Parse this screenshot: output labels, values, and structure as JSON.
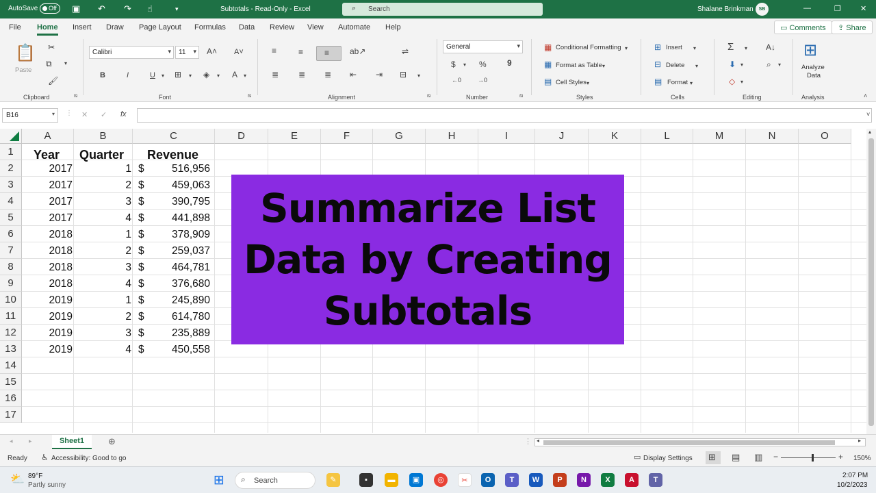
{
  "titlebar": {
    "autosave_label": "AutoSave",
    "autosave_state": "Off",
    "document_title": "Subtotals  -  Read-Only  -  Excel",
    "search_placeholder": "Search",
    "user_name": "Shalane Brinkman",
    "user_initials": "SB"
  },
  "menu": {
    "tabs": [
      "File",
      "Home",
      "Insert",
      "Draw",
      "Page Layout",
      "Formulas",
      "Data",
      "Review",
      "View",
      "Automate",
      "Help"
    ],
    "active": "Home",
    "comments_label": "Comments",
    "share_label": "Share"
  },
  "ribbon": {
    "clipboard": {
      "paste_label": "Paste",
      "group_label": "Clipboard"
    },
    "font": {
      "font_name": "Calibri",
      "font_size": "11",
      "bold": "B",
      "italic": "I",
      "underline": "U",
      "group_label": "Font"
    },
    "alignment": {
      "group_label": "Alignment"
    },
    "number": {
      "format": "General",
      "currency": "$",
      "percent": "%",
      "comma": "9",
      "group_label": "Number"
    },
    "styles": {
      "conditional": "Conditional Formatting",
      "format_table": "Format as Table",
      "cell_styles": "Cell Styles",
      "group_label": "Styles"
    },
    "cells": {
      "insert": "Insert",
      "delete": "Delete",
      "format": "Format",
      "group_label": "Cells"
    },
    "editing": {
      "group_label": "Editing"
    },
    "analysis": {
      "analyze_line1": "Analyze",
      "analyze_line2": "Data",
      "group_label": "Analysis"
    }
  },
  "formula_bar": {
    "name_box": "B16",
    "fx": "fx",
    "content": ""
  },
  "grid": {
    "columns": [
      "A",
      "B",
      "C",
      "D",
      "E",
      "F",
      "G",
      "H",
      "I",
      "J",
      "K",
      "L",
      "M",
      "N",
      "O"
    ],
    "rows": [
      "1",
      "2",
      "3",
      "4",
      "5",
      "6",
      "7",
      "8",
      "9",
      "10",
      "11",
      "12",
      "13",
      "14",
      "15",
      "16",
      "17"
    ],
    "headers": {
      "year": "Year",
      "quarter": "Quarter",
      "revenue": "Revenue"
    },
    "data": [
      {
        "year": "2017",
        "quarter": "1",
        "currency": "$",
        "revenue": "516,956"
      },
      {
        "year": "2017",
        "quarter": "2",
        "currency": "$",
        "revenue": "459,063"
      },
      {
        "year": "2017",
        "quarter": "3",
        "currency": "$",
        "revenue": "390,795"
      },
      {
        "year": "2017",
        "quarter": "4",
        "currency": "$",
        "revenue": "441,898"
      },
      {
        "year": "2018",
        "quarter": "1",
        "currency": "$",
        "revenue": "378,909"
      },
      {
        "year": "2018",
        "quarter": "2",
        "currency": "$",
        "revenue": "259,037"
      },
      {
        "year": "2018",
        "quarter": "3",
        "currency": "$",
        "revenue": "464,781"
      },
      {
        "year": "2018",
        "quarter": "4",
        "currency": "$",
        "revenue": "376,680"
      },
      {
        "year": "2019",
        "quarter": "1",
        "currency": "$",
        "revenue": "245,890"
      },
      {
        "year": "2019",
        "quarter": "2",
        "currency": "$",
        "revenue": "614,780"
      },
      {
        "year": "2019",
        "quarter": "3",
        "currency": "$",
        "revenue": "235,889"
      },
      {
        "year": "2019",
        "quarter": "4",
        "currency": "$",
        "revenue": "450,558"
      }
    ]
  },
  "banner": {
    "text": "Summarize List\nData by Creating\nSubtotals",
    "color": "#8a2be2"
  },
  "sheets": {
    "active": "Sheet1"
  },
  "status": {
    "ready": "Ready",
    "accessibility": "Accessibility: Good to go",
    "display_settings": "Display Settings",
    "zoom": "150%"
  },
  "taskbar": {
    "weather_temp": "89°F",
    "weather_desc": "Partly sunny",
    "search_label": "Search",
    "time": "2:07 PM",
    "date": "10/2/2023"
  },
  "colors": {
    "excel_green": "#1e7145",
    "banner_purple": "#8a2be2"
  }
}
